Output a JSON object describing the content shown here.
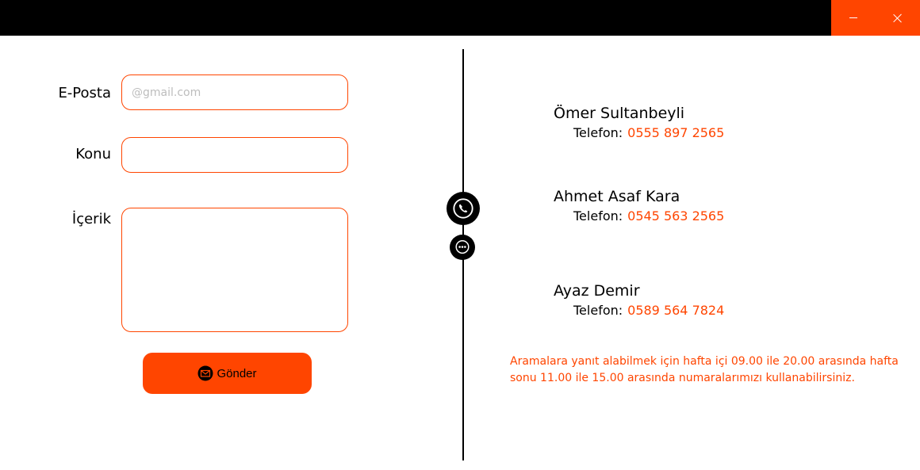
{
  "window": {
    "accent": "#ff4500",
    "minimize_icon": "minimize-icon",
    "close_icon": "close-icon"
  },
  "form": {
    "email_label": "E-Posta",
    "email_placeholder": "@gmail.com",
    "email_value": "",
    "subject_label": "Konu",
    "subject_value": "",
    "content_label": "İçerik",
    "content_value": "",
    "send_label": "Gönder",
    "send_icon": "mail-icon"
  },
  "side_icons": [
    "phone-icon",
    "chat-icon"
  ],
  "contacts": [
    {
      "name": "Ömer Sultanbeyli",
      "phone_label": "Telefon:",
      "phone": "0555 897 2565"
    },
    {
      "name": "Ahmet Asaf Kara",
      "phone_label": "Telefon:",
      "phone": "0545 563 2565"
    },
    {
      "name": "Ayaz Demir",
      "phone_label": "Telefon:",
      "phone": "0589 564 7824"
    }
  ],
  "note": "Aramalara yanıt alabilmek için hafta içi 09.00 ile 20.00 arasında hafta sonu 11.00 ile 15.00 arasında numaralarımızı kullanabilirsiniz."
}
